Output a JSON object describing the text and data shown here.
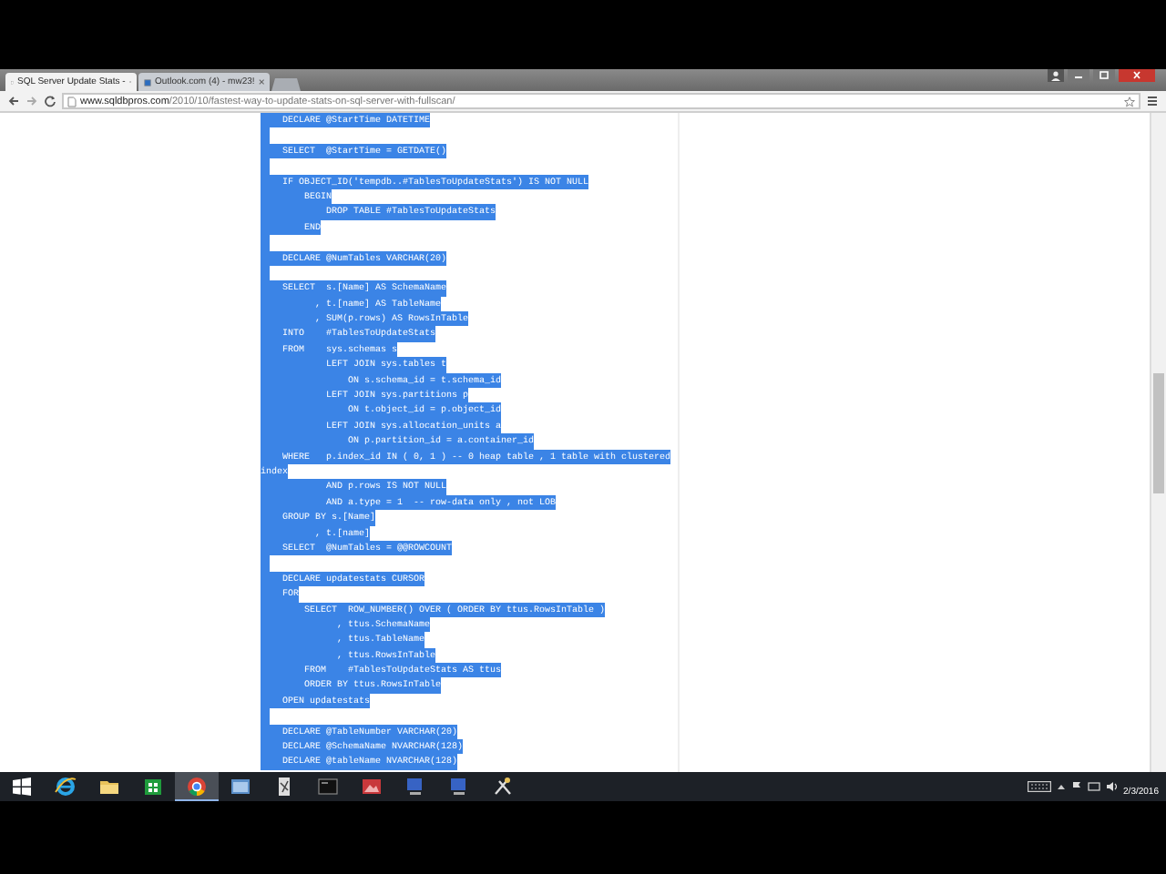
{
  "browser": {
    "tabs": [
      {
        "label": "SQL Server Update Stats -",
        "selected": true
      },
      {
        "label": "Outlook.com (4) - mw23!",
        "selected": false
      }
    ],
    "address": {
      "domain": "www.sqldbpros.com",
      "path": "/2010/10/fastest-way-to-update-stats-on-sql-server-with-fullscan/"
    }
  },
  "code": {
    "selected": true,
    "lines": [
      {
        "kind": "text",
        "text": "    DECLARE @StartTime DATETIME"
      },
      {
        "kind": "blank"
      },
      {
        "kind": "text",
        "text": "    SELECT  @StartTime = GETDATE()"
      },
      {
        "kind": "blank"
      },
      {
        "kind": "text",
        "text": "    IF OBJECT_ID('tempdb..#TablesToUpdateStats') IS NOT NULL"
      },
      {
        "kind": "text",
        "text": "        BEGIN"
      },
      {
        "kind": "text",
        "text": "            DROP TABLE #TablesToUpdateStats"
      },
      {
        "kind": "text",
        "text": "        END"
      },
      {
        "kind": "blank"
      },
      {
        "kind": "text",
        "text": "    DECLARE @NumTables VARCHAR(20)"
      },
      {
        "kind": "blank"
      },
      {
        "kind": "text",
        "text": "    SELECT  s.[Name] AS SchemaName"
      },
      {
        "kind": "text",
        "text": "          , t.[name] AS TableName"
      },
      {
        "kind": "text",
        "text": "          , SUM(p.rows) AS RowsInTable"
      },
      {
        "kind": "text",
        "text": "    INTO    #TablesToUpdateStats"
      },
      {
        "kind": "text",
        "text": "    FROM    sys.schemas s"
      },
      {
        "kind": "text",
        "text": "            LEFT JOIN sys.tables t"
      },
      {
        "kind": "text",
        "text": "                ON s.schema_id = t.schema_id"
      },
      {
        "kind": "text",
        "text": "            LEFT JOIN sys.partitions p"
      },
      {
        "kind": "text",
        "text": "                ON t.object_id = p.object_id"
      },
      {
        "kind": "text",
        "text": "            LEFT JOIN sys.allocation_units a"
      },
      {
        "kind": "text",
        "text": "                ON p.partition_id = a.container_id"
      },
      {
        "kind": "text",
        "text": "    WHERE   p.index_id IN ( 0, 1 ) -- 0 heap table , 1 table with clustered"
      },
      {
        "kind": "text",
        "text": "index"
      },
      {
        "kind": "text",
        "text": "            AND p.rows IS NOT NULL"
      },
      {
        "kind": "text",
        "text": "            AND a.type = 1  -- row-data only , not LOB"
      },
      {
        "kind": "text",
        "text": "    GROUP BY s.[Name]"
      },
      {
        "kind": "text",
        "text": "          , t.[name]"
      },
      {
        "kind": "text",
        "text": "    SELECT  @NumTables = @@ROWCOUNT"
      },
      {
        "kind": "blank"
      },
      {
        "kind": "text",
        "text": "    DECLARE updatestats CURSOR"
      },
      {
        "kind": "text",
        "text": "    FOR"
      },
      {
        "kind": "text",
        "text": "        SELECT  ROW_NUMBER() OVER ( ORDER BY ttus.RowsInTable )"
      },
      {
        "kind": "text",
        "text": "              , ttus.SchemaName"
      },
      {
        "kind": "text",
        "text": "              , ttus.TableName"
      },
      {
        "kind": "text",
        "text": "              , ttus.RowsInTable"
      },
      {
        "kind": "text",
        "text": "        FROM    #TablesToUpdateStats AS ttus"
      },
      {
        "kind": "text",
        "text": "        ORDER BY ttus.RowsInTable"
      },
      {
        "kind": "text",
        "text": "    OPEN updatestats"
      },
      {
        "kind": "blank"
      },
      {
        "kind": "text",
        "text": "    DECLARE @TableNumber VARCHAR(20)"
      },
      {
        "kind": "text",
        "text": "    DECLARE @SchemaName NVARCHAR(128)"
      },
      {
        "kind": "text",
        "text": "    DECLARE @tableName NVARCHAR(128)"
      }
    ]
  },
  "taskbar": {
    "apps": [
      {
        "kind": "ie",
        "selected": false
      },
      {
        "kind": "folder",
        "selected": false
      },
      {
        "kind": "store",
        "selected": false
      },
      {
        "kind": "chrome",
        "selected": true
      },
      {
        "kind": "window",
        "selected": false
      },
      {
        "kind": "document",
        "selected": false
      },
      {
        "kind": "terminal",
        "selected": false
      },
      {
        "kind": "picture-app",
        "selected": false
      },
      {
        "kind": "monitor",
        "selected": false
      },
      {
        "kind": "monitor",
        "selected": false
      },
      {
        "kind": "tools",
        "selected": false
      }
    ],
    "date": "2/3/2016"
  }
}
